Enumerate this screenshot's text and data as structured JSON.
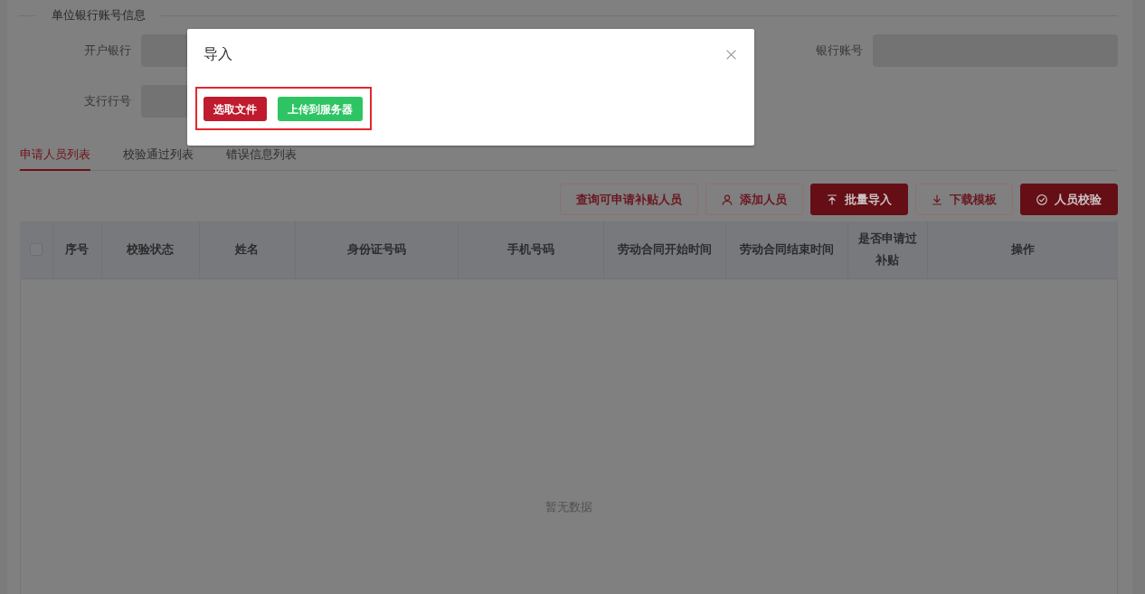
{
  "section": {
    "title": "单位银行账号信息",
    "rows": [
      {
        "left": {
          "label": "开户银行"
        },
        "right": {
          "label": "银行账号"
        }
      },
      {
        "left": {
          "label": "支行行号"
        }
      }
    ]
  },
  "tabs": [
    {
      "label": "申请人员列表",
      "selected": true
    },
    {
      "label": "校验通过列表",
      "selected": false
    },
    {
      "label": "错误信息列表",
      "selected": false
    }
  ],
  "toolbar": [
    {
      "label": "查询可申请补贴人员",
      "kind": "outline"
    },
    {
      "label": "添加人员",
      "kind": "outline"
    },
    {
      "label": "批量导入",
      "kind": "solid"
    },
    {
      "label": "下载模板",
      "kind": "outline"
    },
    {
      "label": "人员校验",
      "kind": "solid"
    }
  ],
  "table": {
    "select_all_checked": false,
    "columns": [
      "序号",
      "校验状态",
      "姓名",
      "身份证号码",
      "手机号码",
      "劳动合同开始时间",
      "劳动合同结束时间",
      "是否申请过补贴",
      "操作"
    ],
    "empty_text": "暂无数据"
  },
  "modal": {
    "title": "导入",
    "actions_highlighted": true,
    "buttons": [
      {
        "label": "选取文件",
        "kind": "danger"
      },
      {
        "label": "上传到服务器",
        "kind": "success"
      }
    ]
  }
}
